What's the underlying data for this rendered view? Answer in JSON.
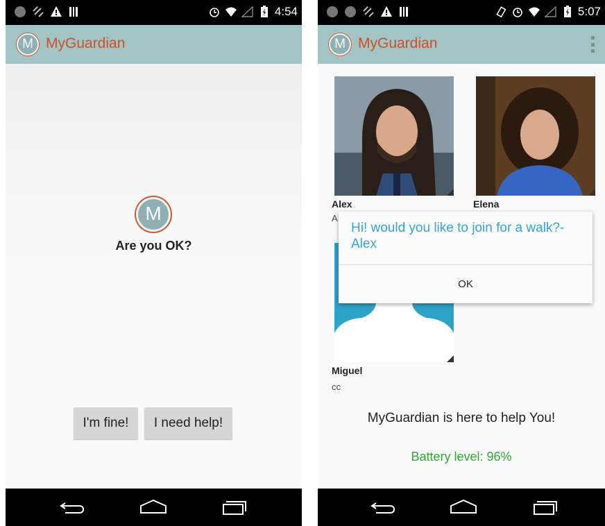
{
  "left_screen": {
    "status_time": "4:54",
    "app_title": "MyGuardian",
    "logo_letter": "M",
    "question": "Are you OK?",
    "buttons": {
      "fine": "I'm fine!",
      "help": "I need help!"
    }
  },
  "right_screen": {
    "status_time": "5:07",
    "app_title": "MyGuardian",
    "logo_letter": "M",
    "contacts": [
      {
        "name": "Alex",
        "sub": "A"
      },
      {
        "name": "Elena",
        "sub": ""
      },
      {
        "name": "Miguel",
        "sub": "cc"
      }
    ],
    "dialog": {
      "message": "Hi! would you like to join for a walk?- Alex",
      "ok_label": "OK"
    },
    "help_text": "MyGuardian is here to help You!",
    "battery_text": "Battery level: 96%"
  },
  "colors": {
    "actionbar": "#a3c4c4",
    "title": "#c9522a",
    "dialog_text": "#33a5d3",
    "battery_text": "#2eaa2e"
  },
  "icons": {
    "nav": [
      "back-icon",
      "home-icon",
      "recents-icon"
    ],
    "status": [
      "signal-icon",
      "alarm-icon",
      "wifi-icon",
      "battery-icon"
    ]
  }
}
